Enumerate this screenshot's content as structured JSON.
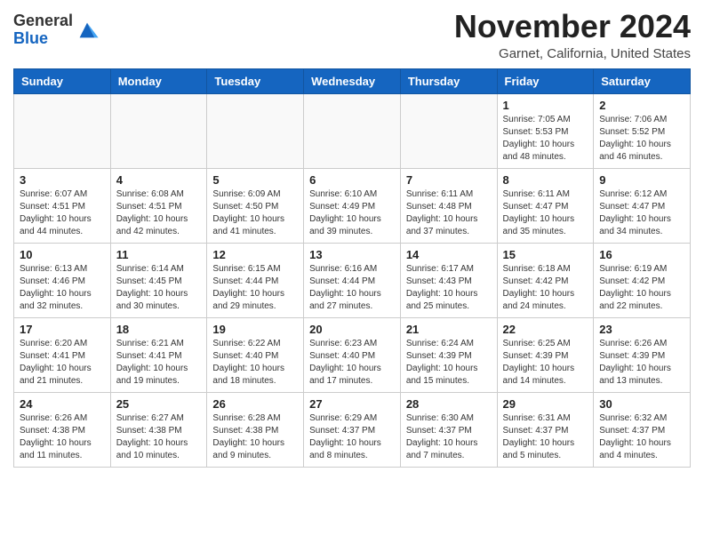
{
  "header": {
    "logo_line1": "General",
    "logo_line2": "Blue",
    "month": "November 2024",
    "location": "Garnet, California, United States"
  },
  "weekdays": [
    "Sunday",
    "Monday",
    "Tuesday",
    "Wednesday",
    "Thursday",
    "Friday",
    "Saturday"
  ],
  "weeks": [
    [
      {
        "day": "",
        "info": ""
      },
      {
        "day": "",
        "info": ""
      },
      {
        "day": "",
        "info": ""
      },
      {
        "day": "",
        "info": ""
      },
      {
        "day": "",
        "info": ""
      },
      {
        "day": "1",
        "info": "Sunrise: 7:05 AM\nSunset: 5:53 PM\nDaylight: 10 hours\nand 48 minutes."
      },
      {
        "day": "2",
        "info": "Sunrise: 7:06 AM\nSunset: 5:52 PM\nDaylight: 10 hours\nand 46 minutes."
      }
    ],
    [
      {
        "day": "3",
        "info": "Sunrise: 6:07 AM\nSunset: 4:51 PM\nDaylight: 10 hours\nand 44 minutes."
      },
      {
        "day": "4",
        "info": "Sunrise: 6:08 AM\nSunset: 4:51 PM\nDaylight: 10 hours\nand 42 minutes."
      },
      {
        "day": "5",
        "info": "Sunrise: 6:09 AM\nSunset: 4:50 PM\nDaylight: 10 hours\nand 41 minutes."
      },
      {
        "day": "6",
        "info": "Sunrise: 6:10 AM\nSunset: 4:49 PM\nDaylight: 10 hours\nand 39 minutes."
      },
      {
        "day": "7",
        "info": "Sunrise: 6:11 AM\nSunset: 4:48 PM\nDaylight: 10 hours\nand 37 minutes."
      },
      {
        "day": "8",
        "info": "Sunrise: 6:11 AM\nSunset: 4:47 PM\nDaylight: 10 hours\nand 35 minutes."
      },
      {
        "day": "9",
        "info": "Sunrise: 6:12 AM\nSunset: 4:47 PM\nDaylight: 10 hours\nand 34 minutes."
      }
    ],
    [
      {
        "day": "10",
        "info": "Sunrise: 6:13 AM\nSunset: 4:46 PM\nDaylight: 10 hours\nand 32 minutes."
      },
      {
        "day": "11",
        "info": "Sunrise: 6:14 AM\nSunset: 4:45 PM\nDaylight: 10 hours\nand 30 minutes."
      },
      {
        "day": "12",
        "info": "Sunrise: 6:15 AM\nSunset: 4:44 PM\nDaylight: 10 hours\nand 29 minutes."
      },
      {
        "day": "13",
        "info": "Sunrise: 6:16 AM\nSunset: 4:44 PM\nDaylight: 10 hours\nand 27 minutes."
      },
      {
        "day": "14",
        "info": "Sunrise: 6:17 AM\nSunset: 4:43 PM\nDaylight: 10 hours\nand 25 minutes."
      },
      {
        "day": "15",
        "info": "Sunrise: 6:18 AM\nSunset: 4:42 PM\nDaylight: 10 hours\nand 24 minutes."
      },
      {
        "day": "16",
        "info": "Sunrise: 6:19 AM\nSunset: 4:42 PM\nDaylight: 10 hours\nand 22 minutes."
      }
    ],
    [
      {
        "day": "17",
        "info": "Sunrise: 6:20 AM\nSunset: 4:41 PM\nDaylight: 10 hours\nand 21 minutes."
      },
      {
        "day": "18",
        "info": "Sunrise: 6:21 AM\nSunset: 4:41 PM\nDaylight: 10 hours\nand 19 minutes."
      },
      {
        "day": "19",
        "info": "Sunrise: 6:22 AM\nSunset: 4:40 PM\nDaylight: 10 hours\nand 18 minutes."
      },
      {
        "day": "20",
        "info": "Sunrise: 6:23 AM\nSunset: 4:40 PM\nDaylight: 10 hours\nand 17 minutes."
      },
      {
        "day": "21",
        "info": "Sunrise: 6:24 AM\nSunset: 4:39 PM\nDaylight: 10 hours\nand 15 minutes."
      },
      {
        "day": "22",
        "info": "Sunrise: 6:25 AM\nSunset: 4:39 PM\nDaylight: 10 hours\nand 14 minutes."
      },
      {
        "day": "23",
        "info": "Sunrise: 6:26 AM\nSunset: 4:39 PM\nDaylight: 10 hours\nand 13 minutes."
      }
    ],
    [
      {
        "day": "24",
        "info": "Sunrise: 6:26 AM\nSunset: 4:38 PM\nDaylight: 10 hours\nand 11 minutes."
      },
      {
        "day": "25",
        "info": "Sunrise: 6:27 AM\nSunset: 4:38 PM\nDaylight: 10 hours\nand 10 minutes."
      },
      {
        "day": "26",
        "info": "Sunrise: 6:28 AM\nSunset: 4:38 PM\nDaylight: 10 hours\nand 9 minutes."
      },
      {
        "day": "27",
        "info": "Sunrise: 6:29 AM\nSunset: 4:37 PM\nDaylight: 10 hours\nand 8 minutes."
      },
      {
        "day": "28",
        "info": "Sunrise: 6:30 AM\nSunset: 4:37 PM\nDaylight: 10 hours\nand 7 minutes."
      },
      {
        "day": "29",
        "info": "Sunrise: 6:31 AM\nSunset: 4:37 PM\nDaylight: 10 hours\nand 5 minutes."
      },
      {
        "day": "30",
        "info": "Sunrise: 6:32 AM\nSunset: 4:37 PM\nDaylight: 10 hours\nand 4 minutes."
      }
    ]
  ]
}
